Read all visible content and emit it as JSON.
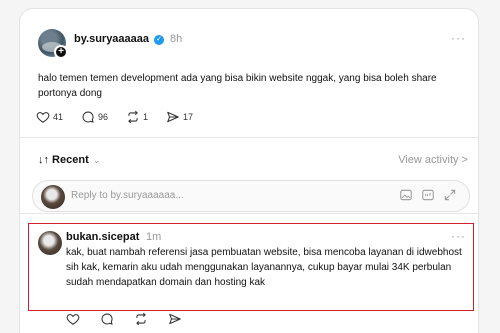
{
  "post": {
    "username": "by.suryaaaaaa",
    "time": "8h",
    "text": "halo temen temen development ada yang bisa bikin website nggak, yang bisa boleh share portonya dong",
    "likes": "41",
    "comments": "96",
    "reposts": "1",
    "shares": "17",
    "more": "···"
  },
  "thread": {
    "sort_label": "↓↑ Recent",
    "view_activity": "View activity >",
    "reply_placeholder": "Reply to by.suryaaaaaa..."
  },
  "reply": {
    "username": "bukan.sicepat",
    "time": "1m",
    "text": "kak, buat nambah referensi jasa pembuatan website, bisa mencoba layanan di idwebhost sih kak, kemarin aku udah menggunakan layanannya, cukup bayar mulai 34K perbulan sudah mendapatkan domain dan hosting kak",
    "more": "···"
  },
  "colors": {
    "verified": "#1d9bf0",
    "highlight": "#d2202f"
  }
}
